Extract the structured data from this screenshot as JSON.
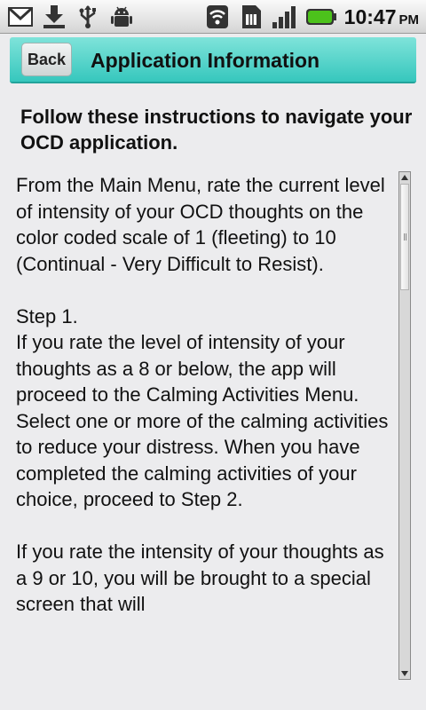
{
  "status_bar": {
    "icons": [
      "gmail-icon",
      "download-icon",
      "usb-icon",
      "android-debug-icon",
      "wifi-icon",
      "sim-icon",
      "signal-icon",
      "battery-icon"
    ],
    "time": "10:47",
    "ampm": "PM",
    "battery_color": "#4cc21b"
  },
  "header": {
    "back_label": "Back",
    "title": "Application Information",
    "accent": "#36c7bd"
  },
  "heading": "Follow these instructions to navigate your OCD application.",
  "body": {
    "paragraphs": [
      "From the Main Menu, rate the current level of intensity of your OCD thoughts on the color coded scale of 1 (fleeting) to 10 (Continual - Very Difficult to Resist).",
      "Step 1.\nIf you rate the level of intensity of your thoughts as a 8 or below, the app will proceed to the Calming Activities Menu. Select one or more of the calming activities to reduce your distress. When you have completed the calming activities of your choice, proceed to Step 2.",
      "If you rate the intensity of your thoughts as a 9 or 10, you will be brought to a special screen that will"
    ]
  }
}
